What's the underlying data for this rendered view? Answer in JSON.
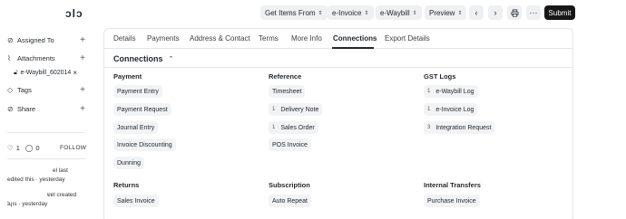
{
  "topbar": {
    "title_fragment": "ɔlɔ",
    "get_items_label": "Get Items From",
    "einvoice_label": "e-Invoice",
    "ewaybill_label": "e-Waybill",
    "preview_label": "Preview",
    "prev_icon": "chevron-left-icon",
    "next_icon": "chevron-right-icon",
    "print_icon": "printer-icon",
    "more_icon": "ellipsis-icon",
    "submit_label": "Submit"
  },
  "sidebar": {
    "assigned_to": "Assigned To",
    "attachments": "Attachments",
    "attachment_file": "e-Waybill_602014",
    "tags": "Tags",
    "share": "Share",
    "like_count": "1",
    "comment_count": "0",
    "follow": "FOLLOW",
    "activity": [
      {
        "line1": "el last",
        "line2": "edited this · yesterday"
      },
      {
        "line1": "ɐɐl created",
        "line2": "ʇɥıs · yesterday"
      }
    ]
  },
  "tabs": [
    "Details",
    "Payments",
    "Address & Contact",
    "Terms",
    "More Info",
    "Connections",
    "Export Details"
  ],
  "active_tab": "Connections",
  "connections": {
    "title": "Connections",
    "payment": {
      "title": "Payment",
      "items": [
        "Payment Entry",
        "Payment Request",
        "Journal Entry",
        "Invoice Discounting",
        "Dunning"
      ]
    },
    "reference": {
      "title": "Reference",
      "items": [
        {
          "label": "Timesheet",
          "count": ""
        },
        {
          "label": "Delivery Note",
          "count": "1"
        },
        {
          "label": "Sales Order",
          "count": "1"
        },
        {
          "label": "POS Invoice",
          "count": ""
        }
      ]
    },
    "gst_logs": {
      "title": "GST Logs",
      "items": [
        {
          "label": "e-Waybill Log",
          "count": "1"
        },
        {
          "label": "e-Invoice Log",
          "count": "1"
        },
        {
          "label": "Integration Request",
          "count": "3"
        }
      ]
    },
    "returns": {
      "title": "Returns",
      "items": [
        "Sales Invoice"
      ]
    },
    "subscription": {
      "title": "Subscription",
      "items": [
        "Auto Repeat"
      ]
    },
    "internal_transfers": {
      "title": "Internal Transfers",
      "items": [
        "Purchase Invoice"
      ]
    }
  }
}
